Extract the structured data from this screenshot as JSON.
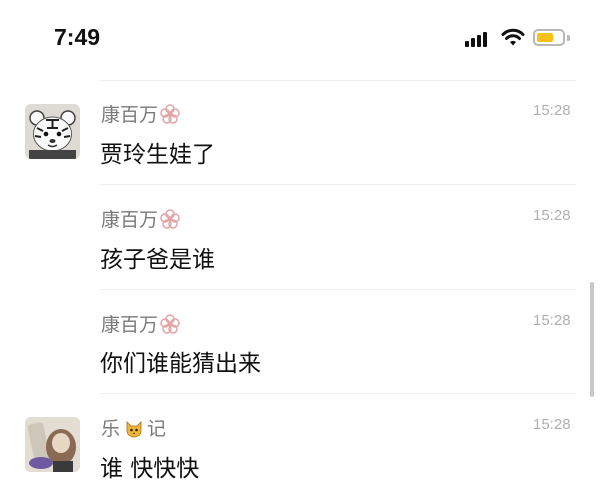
{
  "status_bar": {
    "time": "7:49"
  },
  "messages": [
    {
      "sender": "康百万",
      "time": "15:28",
      "text": "贾玲生娃了"
    },
    {
      "sender": "康百万",
      "time": "15:28",
      "text": "孩子爸是谁"
    },
    {
      "sender": "康百万",
      "time": "15:28",
      "text": "你们谁能猜出来"
    },
    {
      "sender": "乐",
      "sender_suffix": "记",
      "time": "15:28",
      "text": "谁 快快快"
    }
  ],
  "icons": {
    "signal": "cellular-signal-icon",
    "wifi": "wifi-icon",
    "battery": "battery-icon",
    "badge": "flower-badge-icon",
    "cat": "cat-emoji-icon"
  },
  "colors": {
    "battery_fill": "#f5c11a",
    "name_gray": "#7a7a7a",
    "time_gray": "#b0b0b0"
  }
}
